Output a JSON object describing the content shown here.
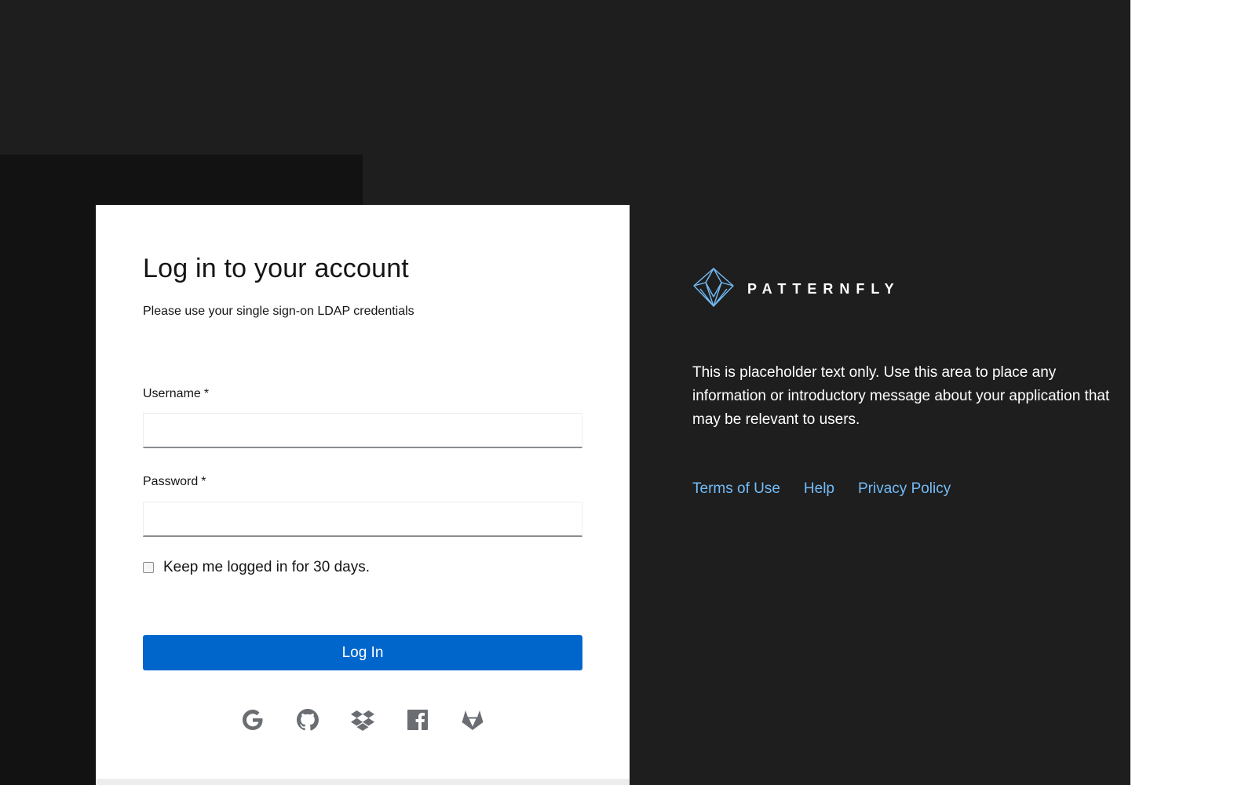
{
  "login": {
    "title": "Log in to your account",
    "subtitle": "Please use your single sign-on LDAP credentials",
    "username_label": "Username",
    "password_label": "Password",
    "required_marker": "*",
    "username_value": "",
    "password_value": "",
    "remember_label": "Keep me logged in for 30 days.",
    "remember_checked": false,
    "submit_label": "Log In",
    "social_icons": [
      "google-icon",
      "github-icon",
      "dropbox-icon",
      "facebook-icon",
      "gitlab-icon"
    ]
  },
  "brand": {
    "name": "PATTERNFLY",
    "logo_icon": "patternfly-logo-icon"
  },
  "info": {
    "text": "This is placeholder text only. Use this area to place any information or introductory message about your application that may be relevant to users."
  },
  "footer": {
    "links": [
      "Terms of Use",
      "Help",
      "Privacy Policy"
    ]
  },
  "colors": {
    "background": "#1e1e1e",
    "panel_shadow": "#121212",
    "primary": "#0066cc",
    "link": "#73bcf7",
    "icon": "#6a6e73"
  }
}
